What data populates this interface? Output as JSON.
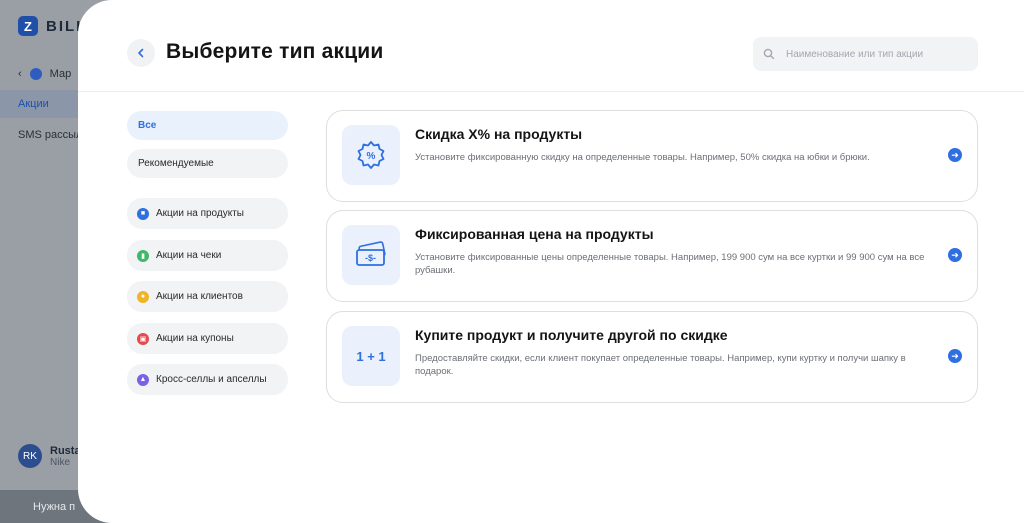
{
  "background": {
    "logo_letter": "Z",
    "logo_text": "BILL",
    "back_label": "Мар",
    "nav_active": "Акции",
    "nav_item": "SMS рассылк",
    "user_initials": "RK",
    "user_name": "Rusta",
    "user_org": "Nike",
    "help_label": "Нужна п"
  },
  "header": {
    "back_icon": "chevron-left-icon",
    "title": "Выберите тип акции",
    "search_placeholder": "Наименование или тип акции"
  },
  "filters": [
    {
      "label": "Все"
    },
    {
      "label": "Рекомендуемые"
    },
    {
      "label": "Акции на продукты",
      "icon": "box-icon",
      "color": "#2f6fe0"
    },
    {
      "label": "Акции на чеки",
      "icon": "receipt-icon",
      "color": "#3fb86b"
    },
    {
      "label": "Акции на клиентов",
      "icon": "user-icon",
      "color": "#f0b429"
    },
    {
      "label": "Акции на купоны",
      "icon": "gift-icon",
      "color": "#e5484d"
    },
    {
      "label": "Кросс-селлы и апселлы",
      "icon": "chart-icon",
      "color": "#7b61e5"
    }
  ],
  "cards": [
    {
      "icon": "percent-badge-icon",
      "title": "Скидка X% на продукты",
      "description": "Установите фиксированную скидку на определенные товары. Например, 50% скидка на юбки и брюки."
    },
    {
      "icon": "banknote-icon",
      "title": "Фиксированная цена на продукты",
      "description": "Установите фиксированные цены определенные товары. Например, 199 900 сум на все куртки и 99 900 сум на все рубашки."
    },
    {
      "icon": "one-plus-one-icon",
      "icon_text": "1 + 1",
      "title": "Купите продукт и получите другой по скидке",
      "description": "Предоставляйте скидки, если клиент покупает определенные товары. Например, купи куртку и получи шапку в подарок."
    }
  ],
  "colors": {
    "accent": "#2f6fe0",
    "active_filter_bg": "#e9f1fd",
    "card_icon_bg": "#eaf1fc"
  }
}
